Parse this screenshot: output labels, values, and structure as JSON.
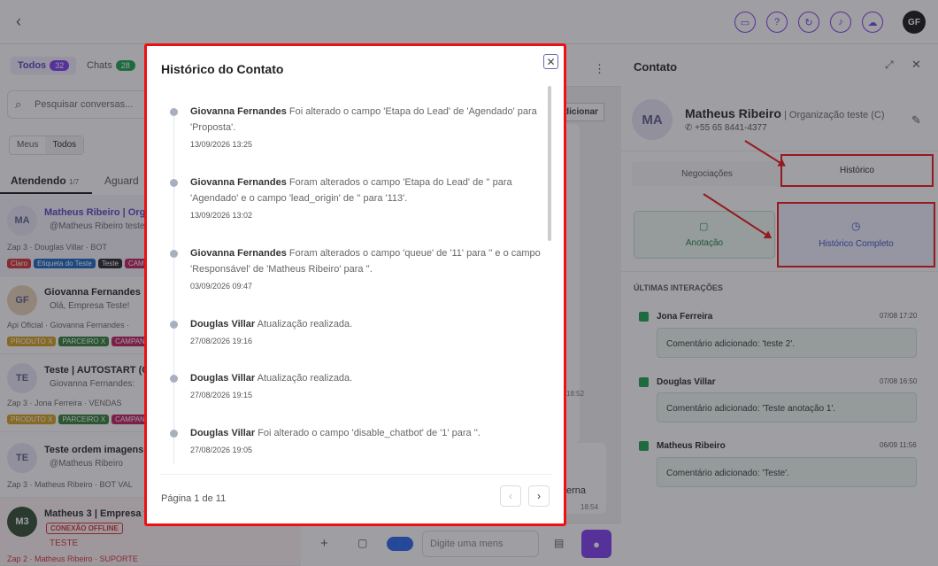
{
  "topbar": {
    "back": "‹",
    "user_initials": "GF",
    "icons": [
      "chat-icon",
      "help-icon",
      "refresh-icon",
      "bell-icon",
      "cloud-icon"
    ]
  },
  "left": {
    "tab_all": "Todos",
    "tab_all_count": "32",
    "tab_chats": "Chats",
    "tab_chats_count": "28",
    "search_placeholder": "Pesquisar conversas...",
    "seg_mine": "Meus",
    "seg_all": "Todos",
    "tab_attending": "Atendendo",
    "tab_attending_count": "1/7",
    "tab_waiting": "Aguard",
    "conversations": [
      {
        "initials": "MA",
        "name": "Matheus Ribeiro | Orga",
        "msg": "@Matheus Ribeiro teste",
        "meta": "Zap 3 · Douglas Villar · BOT",
        "tags": [
          {
            "t": "Claro",
            "c": "#d32f2f"
          },
          {
            "t": "Etiqueta do Teste",
            "c": "#1565c0"
          },
          {
            "t": "Teste",
            "c": "#222"
          },
          {
            "t": "CAMPA",
            "c": "#c2185b"
          }
        ]
      },
      {
        "initials": "GF",
        "name": "Giovanna Fernandes",
        "msg": "Olá, Empresa Teste!",
        "meta": "Api Oficial · Giovanna Fernandes ·",
        "tags": [
          {
            "t": "PRODUTO X",
            "c": "#d4a017"
          },
          {
            "t": "PARCEIRO X",
            "c": "#2e7d32"
          },
          {
            "t": "CAMPANHA",
            "c": "#c2185b"
          }
        ]
      },
      {
        "initials": "TE",
        "name": "Teste | AUTOSTART (C)",
        "msg": "Giovanna Fernandes:",
        "meta": "Zap 3 · Jona Ferreira · VENDAS",
        "tags": [
          {
            "t": "PRODUTO X",
            "c": "#d4a017"
          },
          {
            "t": "PARCEIRO X",
            "c": "#2e7d32"
          },
          {
            "t": "CAMPANHA",
            "c": "#c2185b"
          }
        ]
      },
      {
        "initials": "TE",
        "name": "Teste ordem imagens",
        "msg": "@Matheus Ribeiro",
        "meta": "Zap 3 · Matheus Ribeiro · BOT VAL",
        "tags": []
      },
      {
        "initials": "M3",
        "name": "Matheus 3 | Empresa te",
        "msg": "TESTE",
        "meta": "Zap 2 · Matheus Ribeiro · SUPORTE",
        "badge": "CONEXÃO OFFLINE",
        "tags": []
      }
    ]
  },
  "middle": {
    "add_button": "dicionar",
    "time1": "18:52",
    "time2": "18:54",
    "partial_text": "erna",
    "input_placeholder": "Digite uma mens"
  },
  "modal": {
    "title": "Histórico do Contato",
    "close": "✕",
    "pagination": "Página 1 de 11",
    "prev": "‹",
    "next": "›",
    "entries": [
      {
        "author": "Giovanna Fernandes",
        "text": " Foi alterado o campo 'Etapa do Lead' de 'Agendado' para 'Proposta'.",
        "date": "13/09/2026 13:25"
      },
      {
        "author": "Giovanna Fernandes",
        "text": " Foram alterados o campo 'Etapa do Lead' de '' para 'Agendado' e o campo 'lead_origin' de '' para '113'.",
        "date": "13/09/2026 13:02"
      },
      {
        "author": "Giovanna Fernandes",
        "text": " Foram alterados o campo 'queue' de '11' para '' e o campo 'Responsável' de 'Matheus Ribeiro' para ''.",
        "date": "03/09/2026 09:47"
      },
      {
        "author": "Douglas Villar",
        "text": " Atualização realizada.",
        "date": "27/08/2026 19:16"
      },
      {
        "author": "Douglas Villar",
        "text": " Atualização realizada.",
        "date": "27/08/2026 19:15"
      },
      {
        "author": "Douglas Villar",
        "text": " Foi alterado o campo 'disable_chatbot' de '1' para ''.",
        "date": "27/08/2026 19:05"
      }
    ]
  },
  "right": {
    "title": "Contato",
    "initials": "MA",
    "name": "Matheus Ribeiro",
    "org": "| Organização teste (C)",
    "phone": "+55 65 8441-4377",
    "tab_deals": "Negociações",
    "tab_history": "Histórico",
    "btn_note": "Anotação",
    "btn_full_history": "Histórico Completo",
    "section": "ÚLTIMAS INTERAÇÕES",
    "interactions": [
      {
        "author": "Jona Ferreira",
        "date": "07/08 17:20",
        "text": "Comentário adicionado: 'teste 2'."
      },
      {
        "author": "Douglas Villar",
        "date": "07/08 16:50",
        "text": "Comentário adicionado: 'Teste anotação 1'."
      },
      {
        "author": "Matheus Ribeiro",
        "date": "06/09 11:56",
        "text": "Comentário adicionado: 'Teste'."
      }
    ]
  },
  "colors": {
    "accent": "#7c3aed",
    "highlight": "#e11d1d",
    "green": "#16a34a"
  }
}
